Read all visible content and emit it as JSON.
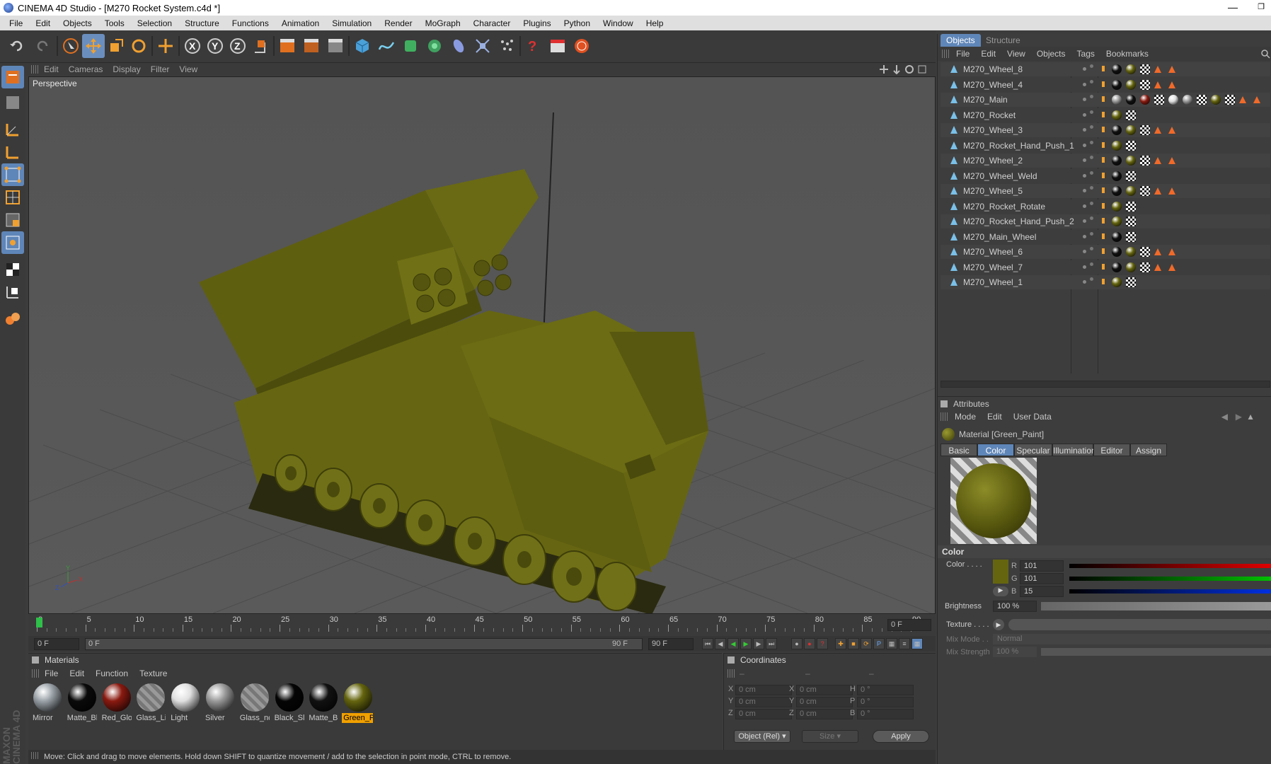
{
  "window": {
    "title": "CINEMA 4D Studio - [M270 Rocket System.c4d *]"
  },
  "menubar": [
    "File",
    "Edit",
    "Objects",
    "Tools",
    "Selection",
    "Structure",
    "Functions",
    "Animation",
    "Simulation",
    "Render",
    "MoGraph",
    "Character",
    "Plugins",
    "Python",
    "Window",
    "Help"
  ],
  "viewport": {
    "menu": [
      "Edit",
      "Cameras",
      "Display",
      "Filter",
      "View"
    ],
    "label": "Perspective",
    "axis": {
      "x": "X",
      "y": "Y",
      "z": "Z"
    }
  },
  "timeline": {
    "ticks": [
      "0",
      "5",
      "10",
      "15",
      "20",
      "25",
      "30",
      "35",
      "40",
      "45",
      "50",
      "55",
      "60",
      "65",
      "70",
      "75",
      "80",
      "85",
      "90"
    ],
    "current_frame": "0 F",
    "start_field": "0 F",
    "range_start": "0 F",
    "range_end": "90 F",
    "end_field": "90 F"
  },
  "materials": {
    "title": "Materials",
    "menu": [
      "File",
      "Edit",
      "Function",
      "Texture"
    ],
    "items": [
      {
        "label": "Mirror",
        "color": "#9aa2a8"
      },
      {
        "label": "Matte_Bl",
        "color": "#0a0a0a"
      },
      {
        "label": "Red_Glo",
        "color": "#8a1a10"
      },
      {
        "label": "Glass_Li",
        "color": "#888888"
      },
      {
        "label": "Light",
        "color": "#e0e0e0"
      },
      {
        "label": "Silver",
        "color": "#9a9a9a"
      },
      {
        "label": "Glass_nc",
        "color": "#777777"
      },
      {
        "label": "Black_Sl",
        "color": "#050505"
      },
      {
        "label": "Matte_Bl",
        "color": "#111111"
      },
      {
        "label": "Green_P",
        "color": "#65650f"
      }
    ],
    "selected_index": 9
  },
  "coordinates": {
    "title": "Coordinates",
    "headers": [
      "–",
      "–",
      "–"
    ],
    "rows": [
      {
        "k1": "X",
        "v1": "0 cm",
        "k2": "X",
        "v2": "0 cm",
        "k3": "H",
        "v3": "0 °"
      },
      {
        "k1": "Y",
        "v1": "0 cm",
        "k2": "Y",
        "v2": "0 cm",
        "k3": "P",
        "v3": "0 °"
      },
      {
        "k1": "Z",
        "v1": "0 cm",
        "k2": "Z",
        "v2": "0 cm",
        "k3": "B",
        "v3": "0 °"
      }
    ],
    "mode": "Object (Rel)",
    "size": "Size",
    "apply": "Apply"
  },
  "status": "Move: Click and drag to move elements. Hold down SHIFT to quantize movement / add to the selection in point mode, CTRL to remove.",
  "objects": {
    "tabs": [
      "Objects",
      "Structure"
    ],
    "menu": [
      "File",
      "Edit",
      "View",
      "Objects",
      "Tags",
      "Bookmarks"
    ],
    "rows": [
      {
        "name": "M270_Wheel_8",
        "tags": "w"
      },
      {
        "name": "M270_Wheel_4",
        "tags": "w"
      },
      {
        "name": "M270_Main",
        "tags": "m"
      },
      {
        "name": "M270_Rocket",
        "tags": "g"
      },
      {
        "name": "M270_Wheel_3",
        "tags": "w"
      },
      {
        "name": "M270_Rocket_Hand_Push_1",
        "tags": "g"
      },
      {
        "name": "M270_Wheel_2",
        "tags": "w"
      },
      {
        "name": "M270_Wheel_Weld",
        "tags": "b"
      },
      {
        "name": "M270_Wheel_5",
        "tags": "w"
      },
      {
        "name": "M270_Rocket_Rotate",
        "tags": "g"
      },
      {
        "name": "M270_Rocket_Hand_Push_2",
        "tags": "g"
      },
      {
        "name": "M270_Main_Wheel",
        "tags": "b"
      },
      {
        "name": "M270_Wheel_6",
        "tags": "w"
      },
      {
        "name": "M270_Wheel_7",
        "tags": "w"
      },
      {
        "name": "M270_Wheel_1",
        "tags": "g"
      }
    ]
  },
  "attributes": {
    "title": "Attributes",
    "menu": [
      "Mode",
      "Edit",
      "User Data"
    ],
    "material_name": "Material [Green_Paint]",
    "tabs": [
      "Basic",
      "Color",
      "Specular",
      "Illumination",
      "Editor",
      "Assign"
    ],
    "active_tab": "Color",
    "section": "Color",
    "color_label": "Color . . . .",
    "swatch": "#65650f",
    "r": "101",
    "g": "101",
    "b": "15",
    "brightness_label": "Brightness",
    "brightness": "100 %",
    "texture_label": "Texture . . . .",
    "mixmode_label": "Mix Mode . .",
    "mixmode": "Normal",
    "mixstrength_label": "Mix Strength",
    "mixstrength": "100 %"
  }
}
